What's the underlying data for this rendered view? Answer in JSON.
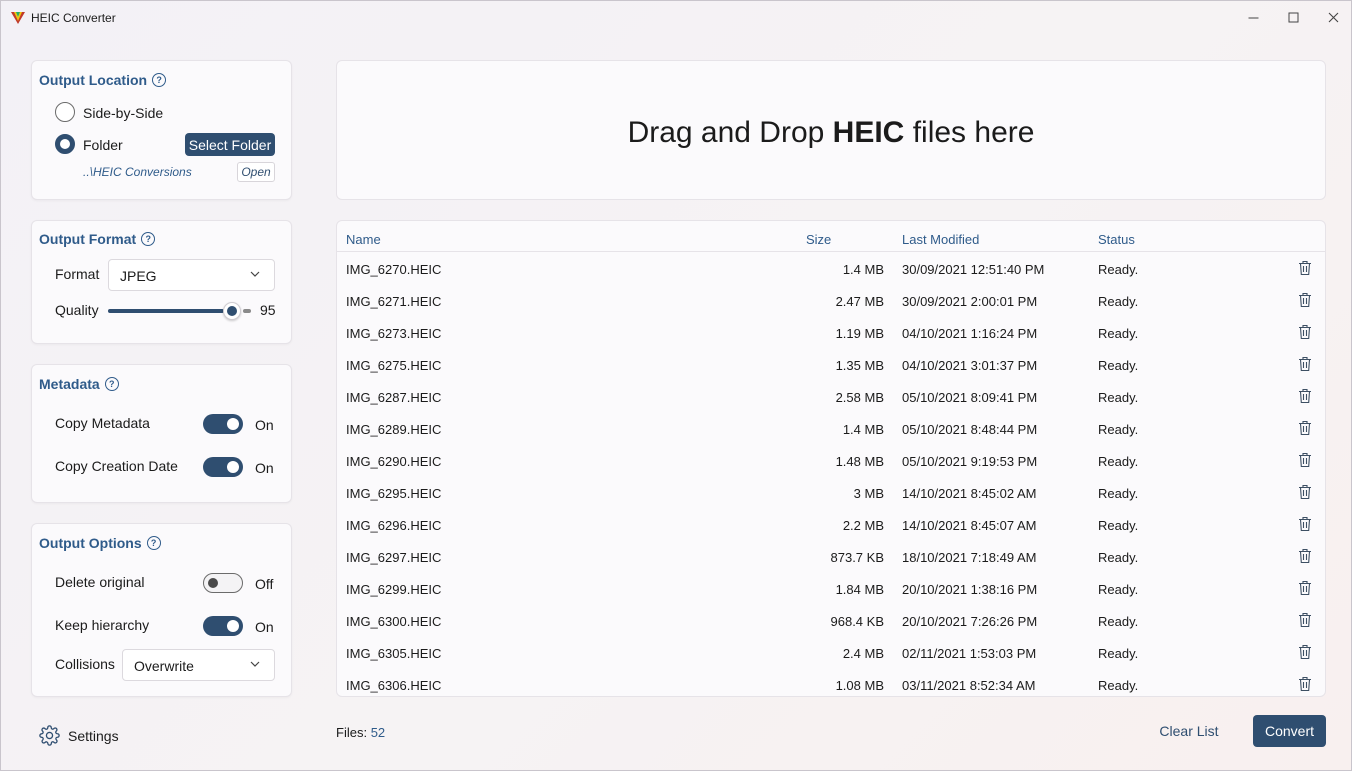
{
  "window": {
    "title": "HEIC Converter"
  },
  "output_location": {
    "title": "Output Location",
    "option_side_by_side": "Side-by-Side",
    "option_folder": "Folder",
    "selected": "Folder",
    "select_folder_label": "Select Folder",
    "folder_path": "..\\HEIC Conversions",
    "open_label": "Open"
  },
  "output_format": {
    "title": "Output Format",
    "format_label": "Format",
    "format_value": "JPEG",
    "quality_label": "Quality",
    "quality_value": "95"
  },
  "metadata": {
    "title": "Metadata",
    "copy_metadata_label": "Copy Metadata",
    "copy_metadata_state": "On",
    "copy_creation_date_label": "Copy Creation Date",
    "copy_creation_date_state": "On"
  },
  "output_options": {
    "title": "Output Options",
    "delete_original_label": "Delete original",
    "delete_original_state": "Off",
    "keep_hierarchy_label": "Keep hierarchy",
    "keep_hierarchy_state": "On",
    "collisions_label": "Collisions",
    "collisions_value": "Overwrite"
  },
  "settings_label": "Settings",
  "dropzone": {
    "prefix": "Drag and Drop ",
    "bold": "HEIC",
    "suffix": " files here"
  },
  "table": {
    "headers": {
      "name": "Name",
      "size": "Size",
      "modified": "Last Modified",
      "status": "Status"
    },
    "rows": [
      {
        "name": "IMG_6270.HEIC",
        "size": "1.4 MB",
        "modified": "30/09/2021 12:51:40 PM",
        "status": "Ready."
      },
      {
        "name": "IMG_6271.HEIC",
        "size": "2.47 MB",
        "modified": "30/09/2021 2:00:01 PM",
        "status": "Ready."
      },
      {
        "name": "IMG_6273.HEIC",
        "size": "1.19 MB",
        "modified": "04/10/2021 1:16:24 PM",
        "status": "Ready."
      },
      {
        "name": "IMG_6275.HEIC",
        "size": "1.35 MB",
        "modified": "04/10/2021 3:01:37 PM",
        "status": "Ready."
      },
      {
        "name": "IMG_6287.HEIC",
        "size": "2.58 MB",
        "modified": "05/10/2021 8:09:41 PM",
        "status": "Ready."
      },
      {
        "name": "IMG_6289.HEIC",
        "size": "1.4 MB",
        "modified": "05/10/2021 8:48:44 PM",
        "status": "Ready."
      },
      {
        "name": "IMG_6290.HEIC",
        "size": "1.48 MB",
        "modified": "05/10/2021 9:19:53 PM",
        "status": "Ready."
      },
      {
        "name": "IMG_6295.HEIC",
        "size": "3 MB",
        "modified": "14/10/2021 8:45:02 AM",
        "status": "Ready."
      },
      {
        "name": "IMG_6296.HEIC",
        "size": "2.2 MB",
        "modified": "14/10/2021 8:45:07 AM",
        "status": "Ready."
      },
      {
        "name": "IMG_6297.HEIC",
        "size": "873.7 KB",
        "modified": "18/10/2021 7:18:49 AM",
        "status": "Ready."
      },
      {
        "name": "IMG_6299.HEIC",
        "size": "1.84 MB",
        "modified": "20/10/2021 1:38:16 PM",
        "status": "Ready."
      },
      {
        "name": "IMG_6300.HEIC",
        "size": "968.4 KB",
        "modified": "20/10/2021 7:26:26 PM",
        "status": "Ready."
      },
      {
        "name": "IMG_6305.HEIC",
        "size": "2.4 MB",
        "modified": "02/11/2021 1:53:03 PM",
        "status": "Ready."
      },
      {
        "name": "IMG_6306.HEIC",
        "size": "1.08 MB",
        "modified": "03/11/2021 8:52:34 AM",
        "status": "Ready."
      }
    ]
  },
  "footer": {
    "files_label": "Files:",
    "files_count": "52",
    "clear_label": "Clear List",
    "convert_label": "Convert"
  },
  "icons": {
    "app": "heic-logo-icon",
    "help": "help-circle-icon",
    "chevron": "chevron-down-icon",
    "settings": "gear-icon",
    "delete": "trash-icon"
  },
  "colors": {
    "accent": "#2f4e70",
    "link": "#2f5b8a"
  }
}
